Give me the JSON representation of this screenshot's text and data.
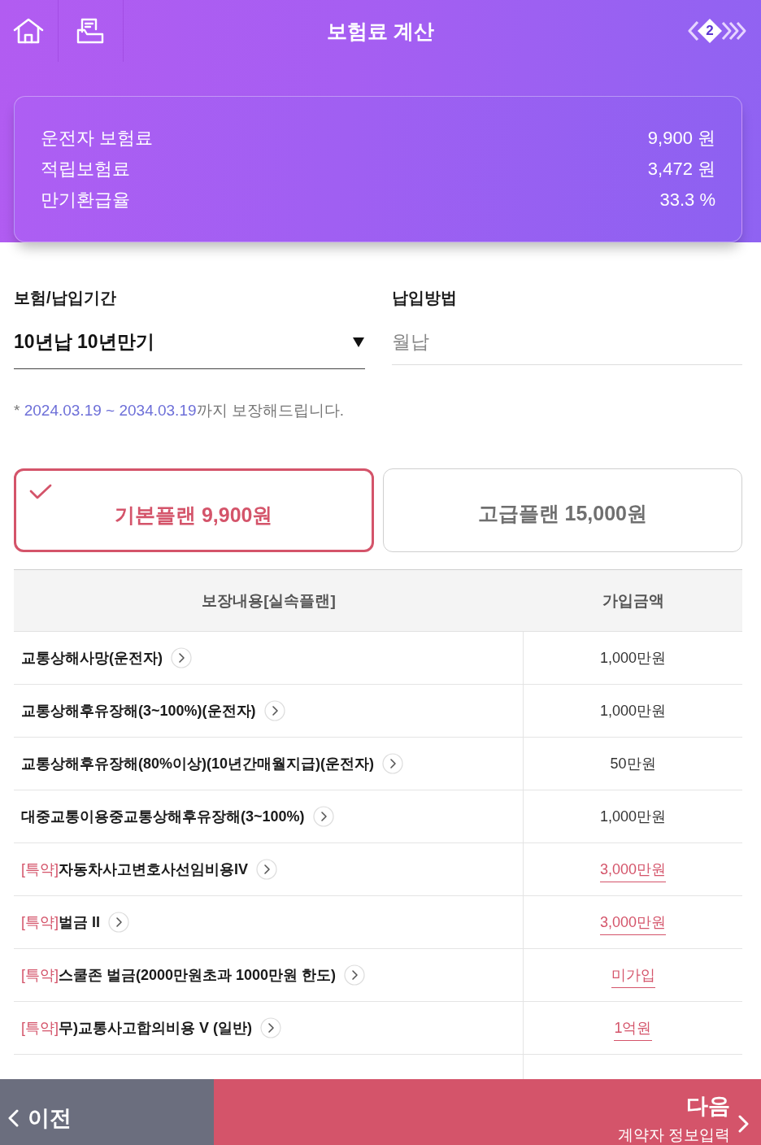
{
  "header": {
    "title": "보험료 계산",
    "step": "2"
  },
  "summary": [
    {
      "label": "운전자 보험료",
      "value": "9,900 원"
    },
    {
      "label": "적립보험료",
      "value": "3,472 원"
    },
    {
      "label": "만기환급율",
      "value": "33.3 %"
    }
  ],
  "form": {
    "fields": [
      {
        "label": "보험/납입기간",
        "value": "10년납 10년만기",
        "kind": "select"
      },
      {
        "label": "납입방법",
        "value": "월납",
        "kind": "readonly"
      }
    ],
    "note": {
      "prefix": "* ",
      "period": "2024.03.19 ~ 2034.03.19",
      "suffix": "까지 보장해드립니다."
    }
  },
  "plans": [
    {
      "label": "기본플랜 9,900원",
      "selected": true
    },
    {
      "label": "고급플랜 15,000원",
      "selected": false
    }
  ],
  "table": {
    "columns": [
      "보장내용[실속플랜]",
      "가입금액"
    ],
    "rows": [
      {
        "kind": "basic",
        "name": "교통상해사망(운전자)",
        "amount": "1,000만원"
      },
      {
        "kind": "basic",
        "name": "교통상해후유장해(3~100%)(운전자)",
        "amount": "1,000만원"
      },
      {
        "kind": "basic",
        "name": "교통상해후유장해(80%이상)(10년간매월지급)(운전자)",
        "amount": "50만원"
      },
      {
        "kind": "basic",
        "name": "대중교통이용중교통상해후유장해(3~100%)",
        "amount": "1,000만원"
      },
      {
        "kind": "rider",
        "tag": "[특약]",
        "name": "자동차사고변호사선임비용IV",
        "amount": "3,000만원"
      },
      {
        "kind": "rider",
        "tag": "[특약]",
        "name": "벌금 II",
        "amount": "3,000만원"
      },
      {
        "kind": "rider",
        "tag": "[특약]",
        "name": "스쿨존 벌금(2000만원초과 1000만원 한도)",
        "amount": "미가입"
      },
      {
        "kind": "rider",
        "tag": "[특약]",
        "name": "무)교통사고합의비용 V (일반)",
        "amount": "1억원"
      }
    ]
  },
  "footer": {
    "prev": "이전",
    "next": "다음",
    "next_sub": "계약자 정보입력"
  }
}
